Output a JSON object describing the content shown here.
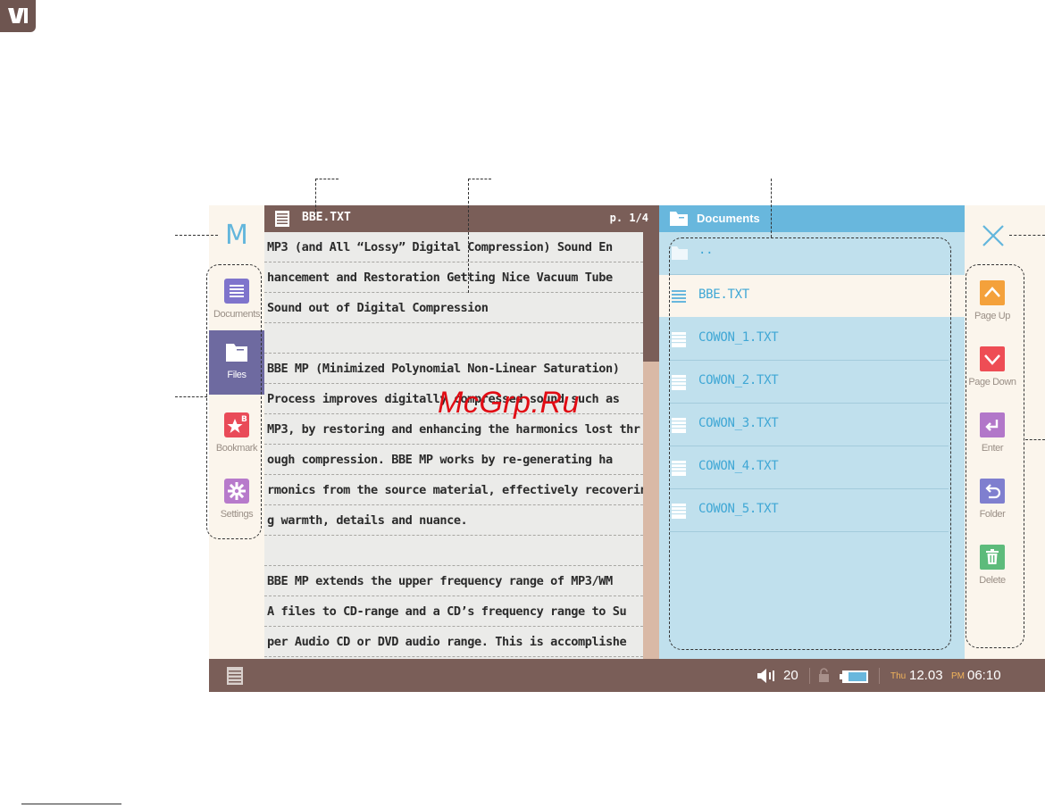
{
  "device": {
    "text_header": {
      "filename": "BBE.TXT",
      "page": "p. 1/4"
    },
    "text_lines": [
      "MP3 (and All “Lossy” Digital Compression) Sound En",
      "hancement and Restoration Getting Nice Vacuum Tube",
      "Sound out of Digital Compression",
      "",
      "BBE MP (Minimized Polynomial Non-Linear Saturation)",
      "Process improves digitally compressed sound such as",
      "MP3, by restoring and enhancing the harmonics lost thr",
      "ough compression. BBE MP works by re-generating ha",
      "rmonics from the source material, effectively recoverin",
      "g warmth, details and nuance.",
      "",
      "BBE MP extends the upper frequency range of MP3/WM",
      "A files to CD-range and a CD’s frequency range to Su",
      "per Audio CD or DVD audio range. This is accomplishe"
    ],
    "left_sidebar": {
      "menu_label": "M",
      "items": [
        {
          "label": "Documents",
          "icon": "documents-icon",
          "color": "#7f74cc"
        },
        {
          "label": "Files",
          "icon": "folder-icon",
          "active": true
        },
        {
          "label": "Bookmark",
          "icon": "bookmark-icon",
          "color": "#e94b58"
        },
        {
          "label": "Settings",
          "icon": "gear-icon",
          "color": "#b77acb"
        }
      ]
    },
    "files_panel": {
      "title": "Documents",
      "parent": "..",
      "files": [
        "BBE.TXT",
        "COWON_1.TXT",
        "COWON_2.TXT",
        "COWON_3.TXT",
        "COWON_4.TXT",
        "COWON_5.TXT"
      ],
      "selected": "BBE.TXT"
    },
    "right_sidebar": {
      "close_icon": "close-icon",
      "actions": [
        {
          "label": "Page Up",
          "icon": "chevron-up-icon",
          "color": "#f4a13b"
        },
        {
          "label": "Page Down",
          "icon": "chevron-down-icon",
          "color": "#ee4d55"
        },
        {
          "label": "Enter",
          "icon": "enter-icon",
          "color": "#b277c9"
        },
        {
          "label": "Folder",
          "icon": "back-arrow-icon",
          "color": "#7f7fcf"
        },
        {
          "label": "Delete",
          "icon": "trash-icon",
          "color": "#5dbb7b"
        }
      ]
    },
    "status_bar": {
      "volume": "20",
      "day": "Thu",
      "date": "12.03",
      "ampm": "PM",
      "time": "06:10"
    }
  },
  "watermark": "McGrp.Ru",
  "colors": {
    "header_brown": "#7a5e58",
    "file_blue": "#68b7dd",
    "panel_light_blue": "#c0e0ed",
    "cream": "#fbf5ec"
  }
}
